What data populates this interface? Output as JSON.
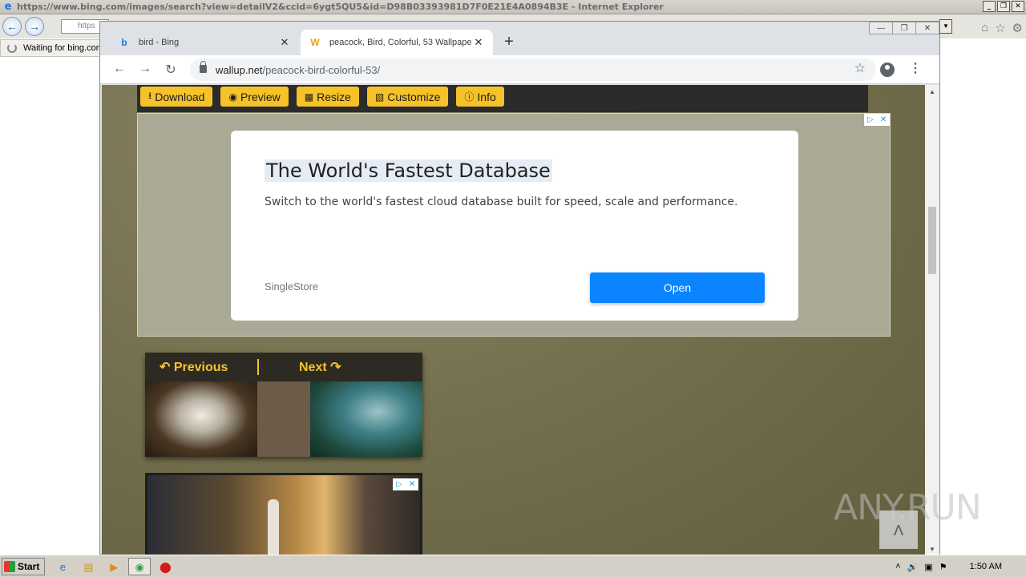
{
  "ie": {
    "title": "https://www.bing.com/images/search?view=detailV2&ccid=6ygt5QU5&id=D98B03393981D7F0E21E4A0894B3E - Internet Explorer",
    "address_partial": "https",
    "tab_label": "Waiting for bing.com",
    "window_buttons": [
      "_",
      "❐",
      "✕"
    ]
  },
  "chrome": {
    "tabs": [
      {
        "title": "bird - Bing",
        "favicon": "b"
      },
      {
        "title": "peacock, Bird, Colorful, 53 Wallpaper",
        "favicon": "W"
      }
    ],
    "url_host": "wallup.net",
    "url_path": "/peacock-bird-colorful-53/"
  },
  "actions": [
    {
      "label": "Download",
      "icon": "download-icon"
    },
    {
      "label": "Preview",
      "icon": "eye-icon"
    },
    {
      "label": "Resize",
      "icon": "resize-icon"
    },
    {
      "label": "Customize",
      "icon": "paint-roller-icon"
    },
    {
      "label": "Info",
      "icon": "info-icon"
    }
  ],
  "ad": {
    "headline": "The World's Fastest Database",
    "body": "Switch to the world's fastest cloud database built for speed, scale and performance.",
    "advertiser": "SingleStore",
    "cta": "Open"
  },
  "pager": {
    "previous": "Previous",
    "next": "Next"
  },
  "watermark": "ANY.RUN",
  "taskbar": {
    "start": "Start",
    "clock": "1:50 AM"
  },
  "colors": {
    "accent": "#f6c229",
    "cta": "#0a84ff",
    "page_bg": "#6a6846"
  }
}
